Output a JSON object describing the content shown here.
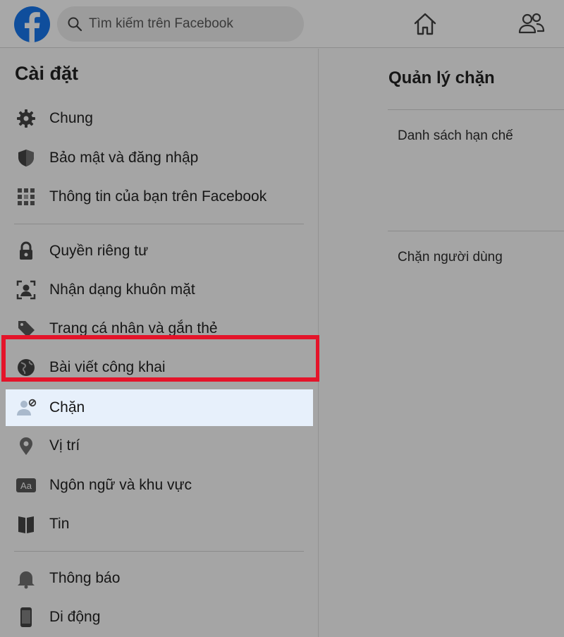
{
  "header": {
    "search_placeholder": "Tìm kiếm trên Facebook",
    "brand_color": "#0f4e9c"
  },
  "sidebar": {
    "title": "Cài đặt",
    "items": [
      {
        "label": "Chung",
        "icon": "gear-icon"
      },
      {
        "label": "Bảo mật và đăng nhập",
        "icon": "shield-icon"
      },
      {
        "label": "Thông tin của bạn trên Facebook",
        "icon": "grid-icon"
      },
      {
        "label": "Quyền riêng tư",
        "icon": "lock-icon"
      },
      {
        "label": "Nhận dạng khuôn mặt",
        "icon": "face-scan-icon"
      },
      {
        "label": "Trang cá nhân và gắn thẻ",
        "icon": "tag-icon"
      },
      {
        "label": "Bài viết công khai",
        "icon": "globe-icon"
      },
      {
        "label": "Chặn",
        "icon": "block-user-icon",
        "selected": true
      },
      {
        "label": "Vị trí",
        "icon": "location-pin-icon"
      },
      {
        "label": "Ngôn ngữ và khu vực",
        "icon": "language-icon"
      },
      {
        "label": "Tin",
        "icon": "book-icon"
      },
      {
        "label": "Thông báo",
        "icon": "bell-icon"
      },
      {
        "label": "Di động",
        "icon": "phone-icon"
      }
    ],
    "highlight_color": "#e4142a"
  },
  "main": {
    "title": "Quản lý chặn",
    "rows": [
      {
        "label": "Danh sách hạn chế"
      },
      {
        "label": "Chặn người dùng"
      }
    ]
  }
}
